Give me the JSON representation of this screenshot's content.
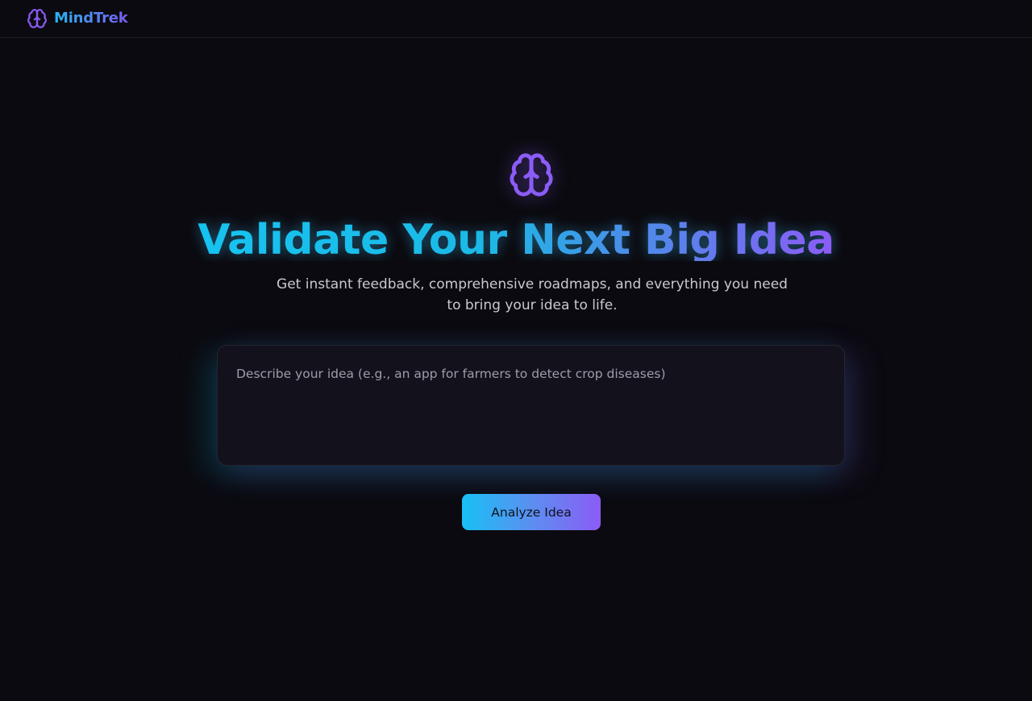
{
  "navbar": {
    "brand_icon": "brain-icon",
    "brand_name": "MindTrek"
  },
  "hero": {
    "icon": "brain-icon",
    "headline": "Validate Your Next Big Idea",
    "subtitle": "Get instant feedback, comprehensive roadmaps, and everything you need to bring your idea to life."
  },
  "idea_input": {
    "value": "",
    "placeholder": "Describe your idea (e.g., an app for farmers to detect crop diseases)"
  },
  "analyze_button": {
    "label": "Analyze Idea"
  },
  "colors": {
    "background": "#0b0a10",
    "accent_cyan": "#16c3f0",
    "accent_purple": "#8b5cf6",
    "input_bg": "#13121c",
    "text_muted": "#c9c9d2"
  }
}
